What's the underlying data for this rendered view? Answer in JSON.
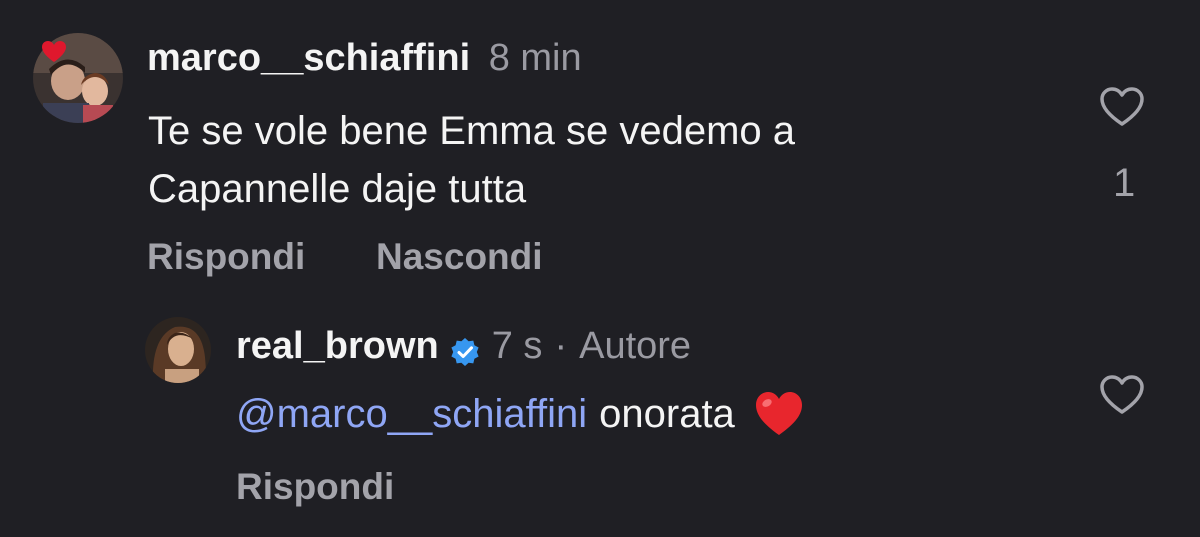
{
  "comments": [
    {
      "username": "marco__schiaffini",
      "time": "8 min",
      "text_line1": "Te se vole bene Emma se vedemo a",
      "text_line2": "Capannelle daje tutta",
      "like_count": "1",
      "actions": {
        "reply": "Rispondi",
        "hide": "Nascondi"
      }
    }
  ],
  "reply": {
    "username": "real_brown",
    "verified_icon": "verified-badge-icon",
    "time": "7 s",
    "separator": "·",
    "author_label": "Autore",
    "mention": "@marco__schiaffini",
    "text": "onorata",
    "emoji": "❤️",
    "actions": {
      "reply": "Rispondi"
    }
  },
  "colors": {
    "background": "#1f1f24",
    "mention": "#8fa6f5",
    "verified": "#3797f0",
    "heart_emoji": "#e8262d",
    "avatar_story_heart": "#e0182d"
  }
}
